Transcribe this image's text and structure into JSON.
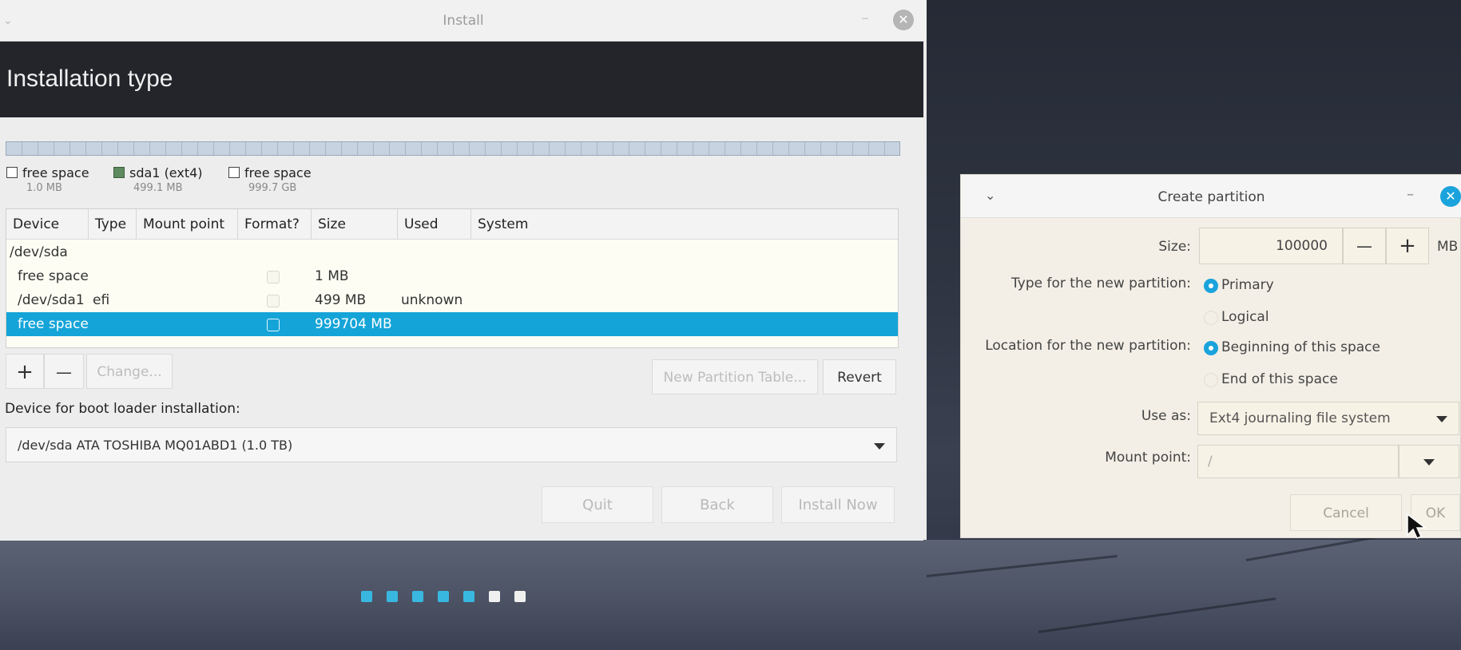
{
  "install_window": {
    "title": "Install",
    "header_title": "Installation type",
    "legend": [
      {
        "label": "free space",
        "size": "1.0 MB"
      },
      {
        "label": "sda1 (ext4)",
        "size": "499.1 MB"
      },
      {
        "label": "free space",
        "size": "999.7 GB"
      }
    ],
    "table": {
      "columns": [
        "Device",
        "Type",
        "Mount point",
        "Format?",
        "Size",
        "Used",
        "System"
      ],
      "rows": [
        {
          "device": "/dev/sda",
          "type": "",
          "mount": "",
          "size": "",
          "used": ""
        },
        {
          "device": "free space",
          "type": "",
          "mount": "",
          "size": "1 MB",
          "used": ""
        },
        {
          "device": "/dev/sda1",
          "type": "efi",
          "mount": "",
          "size": "499 MB",
          "used": "unknown"
        },
        {
          "device": "free space",
          "type": "",
          "mount": "",
          "size": "999704 MB",
          "used": ""
        }
      ]
    },
    "buttons": {
      "add": "+",
      "remove": "—",
      "change": "Change...",
      "new_partition_table": "New Partition Table...",
      "revert": "Revert"
    },
    "boot_loader_label": "Device for boot loader installation:",
    "boot_loader_value": "/dev/sda   ATA TOSHIBA MQ01ABD1 (1.0 TB)",
    "nav": {
      "quit": "Quit",
      "back": "Back",
      "install_now": "Install Now"
    },
    "progress_steps_done": 5,
    "progress_steps_total": 7
  },
  "dialog": {
    "title": "Create partition",
    "size_label": "Size:",
    "size_value": "100000",
    "size_unit": "MB",
    "minus": "—",
    "plus": "+",
    "type_label": "Type for the new partition:",
    "type_primary": "Primary",
    "type_logical": "Logical",
    "location_label": "Location for the new partition:",
    "location_beginning": "Beginning of this space",
    "location_end": "End of this space",
    "use_as_label": "Use as:",
    "use_as_value": "Ext4 journaling file system",
    "mount_label": "Mount point:",
    "mount_value": "/",
    "cancel": "Cancel",
    "ok": "OK"
  },
  "colors": {
    "accent": "#15a4d8",
    "header_band": "#23252b"
  }
}
